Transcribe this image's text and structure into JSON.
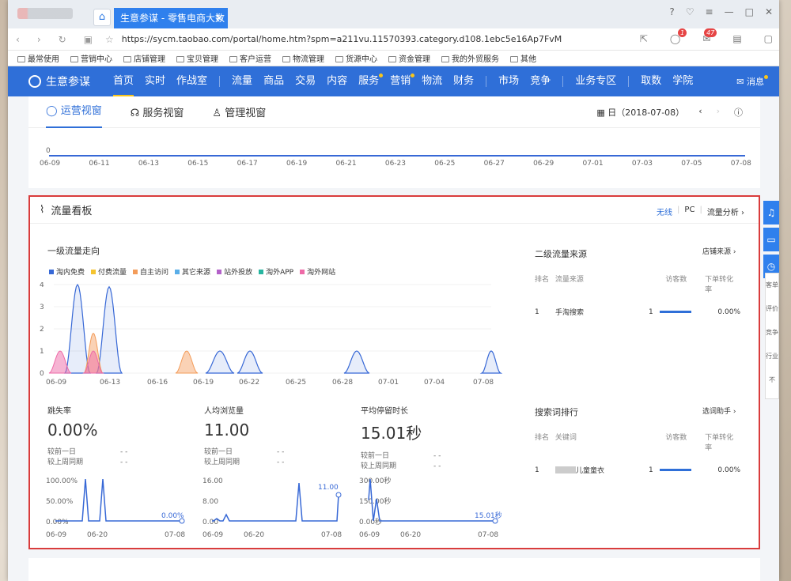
{
  "browser": {
    "tab_title": "生意参谋 - 零售电商大数",
    "url": "https://sycm.taobao.com/portal/home.htm?spm=a211vu.11570393.category.d108.1ebc5e16Ap7FvM",
    "badge1": "1",
    "badge2": "47"
  },
  "bookmarks": [
    "最常使用",
    "营销中心",
    "店铺管理",
    "宝贝管理",
    "客户运营",
    "物流管理",
    "货源中心",
    "资金管理",
    "我的外贸服务",
    "其他"
  ],
  "nav": {
    "logo": "生意参谋",
    "items": [
      "首页",
      "实时",
      "作战室",
      "流量",
      "商品",
      "交易",
      "内容",
      "服务",
      "营销",
      "物流",
      "财务",
      "市场",
      "竞争",
      "业务专区",
      "取数",
      "学院"
    ],
    "msg": "消息"
  },
  "view_tabs": [
    "运营视窗",
    "服务视窗",
    "管理视窗"
  ],
  "date": "日（2018-07-08）",
  "top_chart": {
    "zero": "0",
    "ticks": [
      "06-09",
      "06-11",
      "06-13",
      "06-15",
      "06-17",
      "06-19",
      "06-21",
      "06-23",
      "06-25",
      "06-27",
      "06-29",
      "07-01",
      "07-03",
      "07-05",
      "07-08"
    ]
  },
  "panel": {
    "title": "流量看板",
    "filters": [
      "无线",
      "PC",
      "流量分析 ›"
    ],
    "trend_title": "一级流量走向",
    "source_title": "二级流量来源",
    "source_link": "店铺来源 ›",
    "search_title": "搜索词排行",
    "search_link": "选词助手 ›"
  },
  "chart_data": {
    "type": "area",
    "x": [
      "06-09",
      "06-13",
      "06-16",
      "06-19",
      "06-22",
      "06-25",
      "06-28",
      "07-01",
      "07-04",
      "07-08"
    ],
    "ylim": [
      0,
      4
    ],
    "yticks": [
      "0",
      "1",
      "2",
      "3",
      "4"
    ],
    "series": [
      {
        "name": "淘内免费",
        "color": "#3768d6"
      },
      {
        "name": "付费流量",
        "color": "#f5c430"
      },
      {
        "name": "自主访问",
        "color": "#f39c5a"
      },
      {
        "name": "其它来源",
        "color": "#5aaee8"
      },
      {
        "name": "站外投放",
        "color": "#b361c9"
      },
      {
        "name": "淘外APP",
        "color": "#27b5a0"
      },
      {
        "name": "淘外网站",
        "color": "#ee6aa7"
      }
    ]
  },
  "source_table": {
    "headers": [
      "排名",
      "流量来源",
      "访客数",
      "下单转化率"
    ],
    "rows": [
      [
        "1",
        "手淘搜索",
        "1",
        "0.00%"
      ]
    ]
  },
  "search_table": {
    "headers": [
      "排名",
      "关键词",
      "访客数",
      "下单转化率"
    ],
    "rows": [
      [
        "1",
        "儿童童衣",
        "1",
        "0.00%"
      ]
    ]
  },
  "kpis": [
    {
      "label": "跳失率",
      "value": "0.00%",
      "day": "较前一日",
      "week": "较上周同期",
      "dash": "- -",
      "ymax": "100.00%",
      "ymid": "50.00%",
      "ymin": "0.00%",
      "last": "0.00%",
      "x": [
        "06-09",
        "06-20",
        "07-08"
      ]
    },
    {
      "label": "人均浏览量",
      "value": "11.00",
      "day": "较前一日",
      "week": "较上周同期",
      "dash": "- -",
      "ymax": "16.00",
      "ymid": "8.00",
      "ymin": "0.00",
      "last": "11.00",
      "x": [
        "06-09",
        "06-20",
        "07-08"
      ]
    },
    {
      "label": "平均停留时长",
      "value": "15.01秒",
      "day": "较前一日",
      "week": "较上周同期",
      "dash": "- -",
      "ymax": "300.00秒",
      "ymid": "150.00秒",
      "ymin": "0.00秒",
      "last": "15.01秒",
      "x": [
        "06-09",
        "06-20",
        "07-08"
      ]
    }
  ],
  "side": [
    "客单",
    "评价",
    "竞争",
    "行业",
    "不"
  ]
}
